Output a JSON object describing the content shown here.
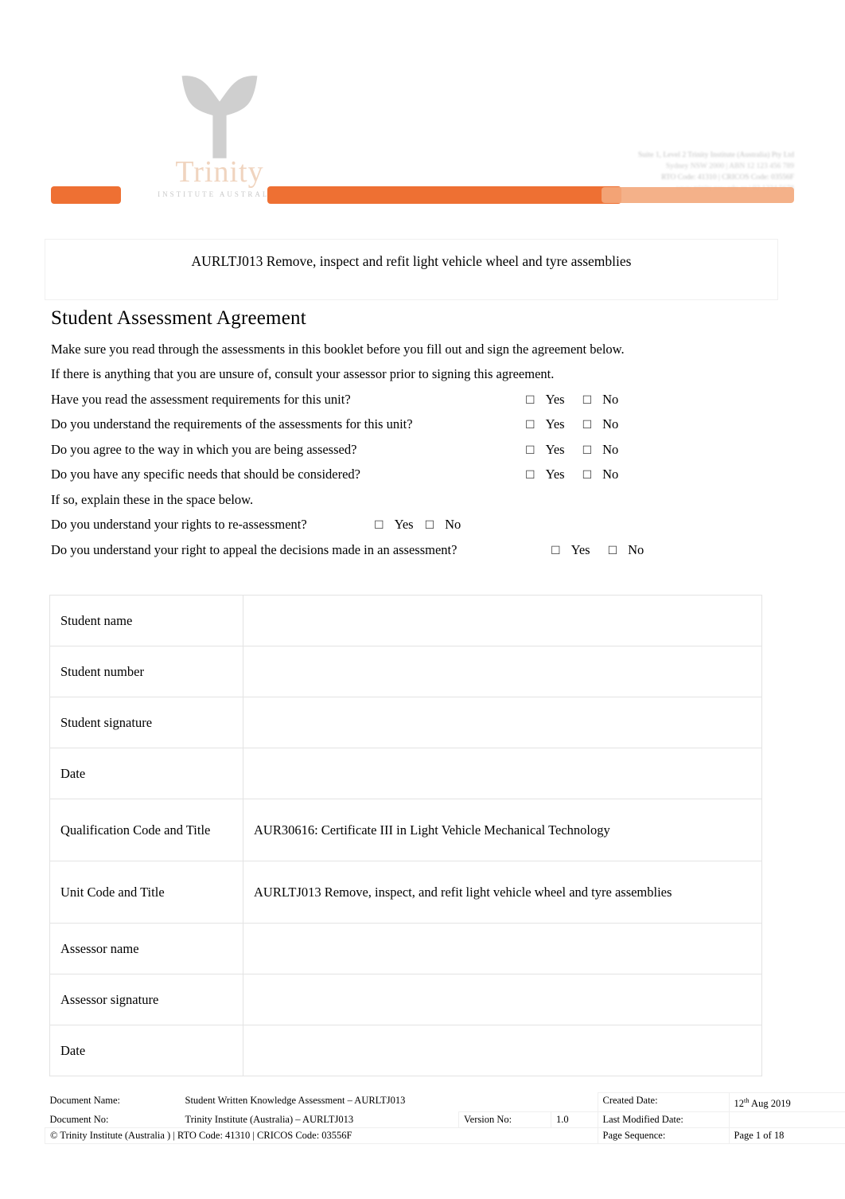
{
  "document": {
    "header": {
      "logo": {
        "wordmark": "Trinity",
        "tagline": "INSTITUTE AUSTRALIA"
      },
      "org_lines": [
        "Suite 1, Level 2 Trinity Institute (Australia) Pty Ltd",
        "Sydney NSW 2000 | ABN 12 123 456 789",
        "RTO Code: 41310 | CRICOS Code: 03556F",
        "www.trinity.nsw.edu.au | 02 1234 5678"
      ],
      "accent_color": "#ee7033"
    },
    "title_banner": "AURLTJ013 Remove, inspect and refit light vehicle wheel and tyre assemblies",
    "heading": "Student Assessment Agreement",
    "intro": [
      "Make sure you read through the assessments in this booklet before you fill out and sign the agreement below.",
      "If there is anything that you are unsure of, consult your assessor prior to signing this agreement."
    ],
    "questions": [
      {
        "text": "Have you read the assessment requirements for this unit?",
        "yes": "Yes",
        "no": "No",
        "checkbox": "checkbox-glyph"
      },
      {
        "text": "Do you understand the requirements of the assessments for this unit?",
        "yes": "Yes",
        "no": "No",
        "checkbox": "checkbox-glyph"
      },
      {
        "text": "Do you agree to the way in which you are being assessed?",
        "yes": "Yes",
        "no": "No",
        "checkbox": "checkbox-glyph"
      },
      {
        "text": "Do you have any specific needs that should be considered?",
        "yes": "Yes",
        "no": "No",
        "checkbox": "checkbox-glyph"
      }
    ],
    "note": "If so, explain these in the space below.",
    "questions2": [
      {
        "text": "Do you understand your rights to re-assessment?",
        "yes": "Yes",
        "no": "No",
        "checkbox": "checkbox-glyph"
      },
      {
        "text": "Do you understand your right to appeal the decisions made in an assessment?",
        "yes": "Yes",
        "no": "No",
        "checkbox": "checkbox-glyph"
      }
    ],
    "agreement_table": {
      "rows": [
        {
          "label": "Student name",
          "value": ""
        },
        {
          "label": "Student number",
          "value": ""
        },
        {
          "label": "Student signature",
          "value": ""
        },
        {
          "label": "Date",
          "value": ""
        },
        {
          "label": "Qualification Code and Title",
          "value": "AUR30616: Certificate III in Light Vehicle Mechanical Technology"
        },
        {
          "label": "Unit Code and Title",
          "value": "AURLTJ013 Remove, inspect, and refit light vehicle wheel and tyre assemblies"
        },
        {
          "label": "Assessor name",
          "value": ""
        },
        {
          "label": "Assessor signature",
          "value": ""
        },
        {
          "label": "Date",
          "value": ""
        }
      ]
    },
    "footer": {
      "document_name_label": "Document Name:",
      "document_name_value": "Student Written Knowledge Assessment – AURLTJ013",
      "document_no_label": "Document No:",
      "document_no_value": "Trinity Institute (Australia)   – AURLTJ013",
      "version_label": "Version No:",
      "version_value": "1.0",
      "created_date_label": "Created Date:",
      "created_date_value_num": "12",
      "created_date_value_sup": "th",
      "created_date_value_rest": " Aug 2019",
      "last_modified_label": "Last Modified Date:",
      "last_modified_value": "",
      "page_sequence_label": "Page Sequence:",
      "page_sequence_value": "Page   1 of 18",
      "copyright": "© Trinity Institute (Australia      ) | RTO Code: 41310 | CRICOS Code: 03556F"
    }
  }
}
